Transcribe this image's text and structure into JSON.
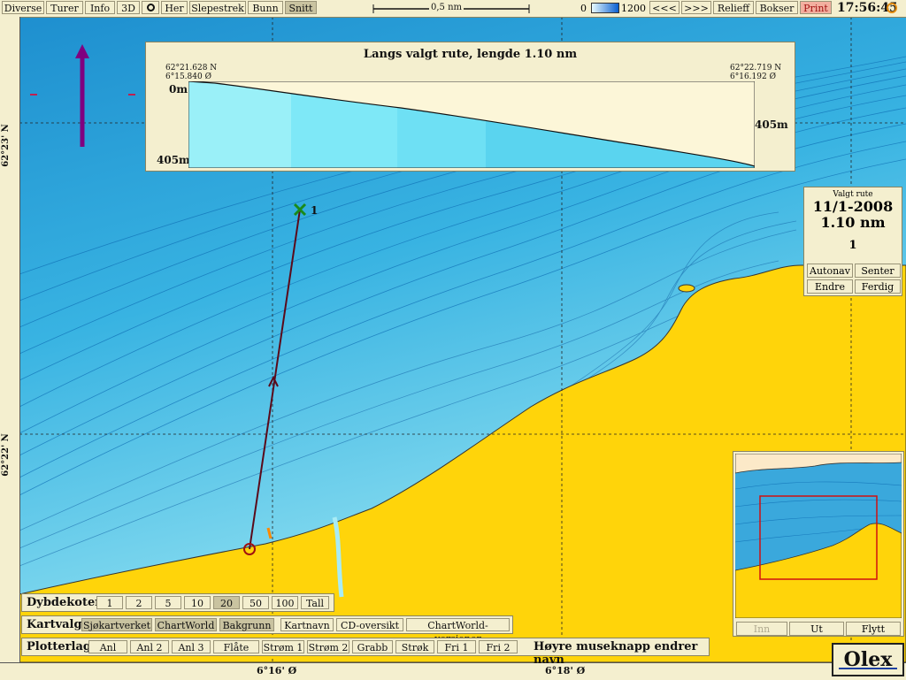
{
  "toolbar": {
    "items": [
      "Diverse",
      "Turer",
      "Info",
      "3D",
      "Her",
      "Slepestrek",
      "Bunn",
      "Snitt"
    ],
    "scale_label": "0,5 nm",
    "depth_min": "0",
    "depth_max": "1200",
    "nav": [
      "<<<",
      ">>>"
    ],
    "relieff": "Relieff",
    "bokser": "Bokser",
    "print": "Print",
    "clock": "17:56:45"
  },
  "chart": {
    "lat_labels": [
      "62°23' N",
      "62°22' N"
    ],
    "lon_labels": [
      "6°16' Ø",
      "6°18' Ø"
    ],
    "waypoint_label": "1",
    "colors": {
      "land": "#ffd40a",
      "water_deep": "#2a9fd6",
      "water_shallow": "#a8ecf5",
      "route": "#5a0a1a"
    }
  },
  "profile": {
    "title": "Langs valgt rute, lengde 1.10 nm",
    "start_lat": "62°21.628 N",
    "start_lon": "6°15.840 Ø",
    "end_lat": "62°22.719 N",
    "end_lon": "6°16.192 Ø",
    "depth_top": "0m",
    "depth_bottom": "405m",
    "depth_right": "405m"
  },
  "route_panel": {
    "heading": "Valgt rute",
    "date": "11/1-2008",
    "length": "1.10 nm",
    "count": "1",
    "buttons": [
      "Autonav",
      "Senter",
      "Endre",
      "Ferdig"
    ]
  },
  "minimap": {
    "buttons": [
      "Inn",
      "Ut",
      "Flytt"
    ]
  },
  "dybdekoter": {
    "label": "Dybdekoter",
    "options": [
      "1",
      "2",
      "5",
      "10",
      "20",
      "50",
      "100",
      "Tall"
    ],
    "selected": "20"
  },
  "kartvalg": {
    "label": "Kartvalg",
    "options": [
      "Sjøkartverket",
      "ChartWorld",
      "Bakgrunn",
      "Kartnavn",
      "CD-oversikt",
      "ChartWorld-versjoner"
    ]
  },
  "plotterlag": {
    "label": "Plotterlag",
    "options": [
      "Anl",
      "Anl 2",
      "Anl 3",
      "Flåte",
      "Strøm 1",
      "Strøm 2",
      "Grabb",
      "Strøk",
      "Fri 1",
      "Fri 2"
    ],
    "hint": "Høyre museknapp endrer navn"
  },
  "brand": "Olex"
}
